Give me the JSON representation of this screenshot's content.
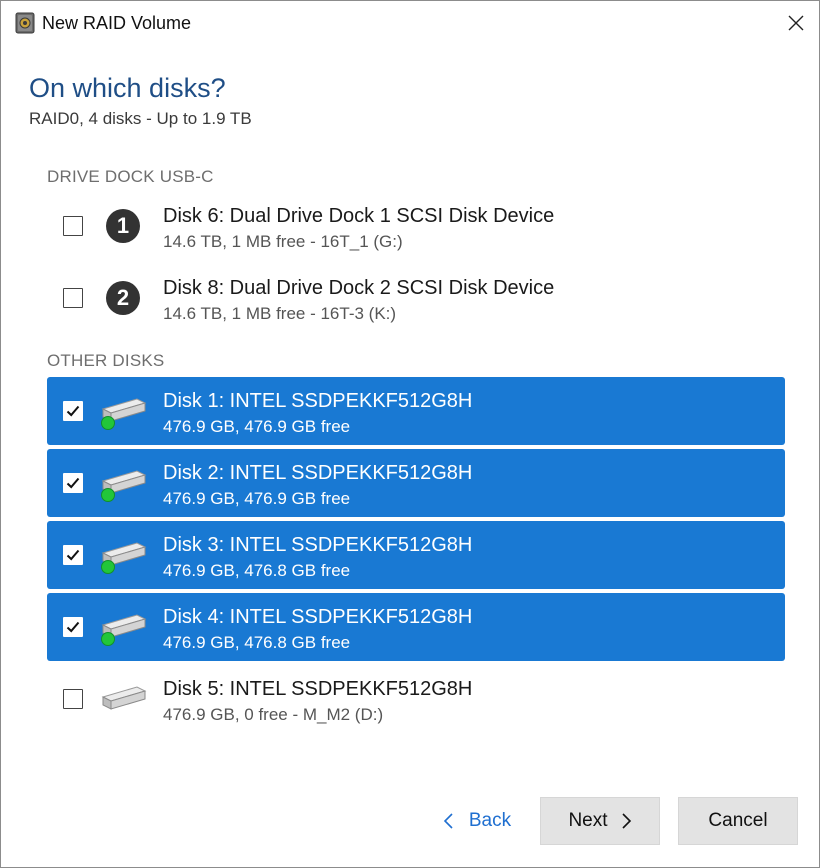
{
  "window": {
    "title": "New RAID Volume"
  },
  "page": {
    "heading": "On which disks?",
    "subheading": "RAID0, 4 disks - Up to 1.9 TB"
  },
  "groups": [
    {
      "label": "DRIVE DOCK USB-C",
      "disks": [
        {
          "badge": "1",
          "name": "Disk 6: Dual Drive Dock 1 SCSI Disk Device",
          "info": "14.6 TB, 1 MB free - 16T_1 (G:)",
          "checked": false
        },
        {
          "badge": "2",
          "name": "Disk 8: Dual Drive Dock 2 SCSI Disk Device",
          "info": "14.6 TB, 1 MB free - 16T-3 (K:)",
          "checked": false
        }
      ]
    },
    {
      "label": "OTHER DISKS",
      "disks": [
        {
          "name": "Disk 1: INTEL SSDPEKKF512G8H",
          "info": "476.9 GB, 476.9 GB free",
          "checked": true,
          "status": "green"
        },
        {
          "name": "Disk 2: INTEL SSDPEKKF512G8H",
          "info": "476.9 GB, 476.9 GB free",
          "checked": true,
          "status": "green"
        },
        {
          "name": "Disk 3: INTEL SSDPEKKF512G8H",
          "info": "476.9 GB, 476.8 GB free",
          "checked": true,
          "status": "green"
        },
        {
          "name": "Disk 4: INTEL SSDPEKKF512G8H",
          "info": "476.9 GB, 476.8 GB free",
          "checked": true,
          "status": "green"
        },
        {
          "name": "Disk 5: INTEL SSDPEKKF512G8H",
          "info": "476.9 GB, 0  free - M_M2 (D:)",
          "checked": false
        }
      ]
    }
  ],
  "footer": {
    "back_label": "Back",
    "next_label": "Next",
    "cancel_label": "Cancel"
  },
  "colors": {
    "selected_bg": "#1979d3",
    "heading": "#1f4e86",
    "status_green": "#22c63a",
    "link_blue": "#1f6fd0"
  },
  "icons": [
    "app-icon",
    "close-icon",
    "checkmark-icon",
    "number-badge-icon",
    "drive-icon",
    "status-dot-icon",
    "chevron-left-icon",
    "chevron-right-icon"
  ]
}
